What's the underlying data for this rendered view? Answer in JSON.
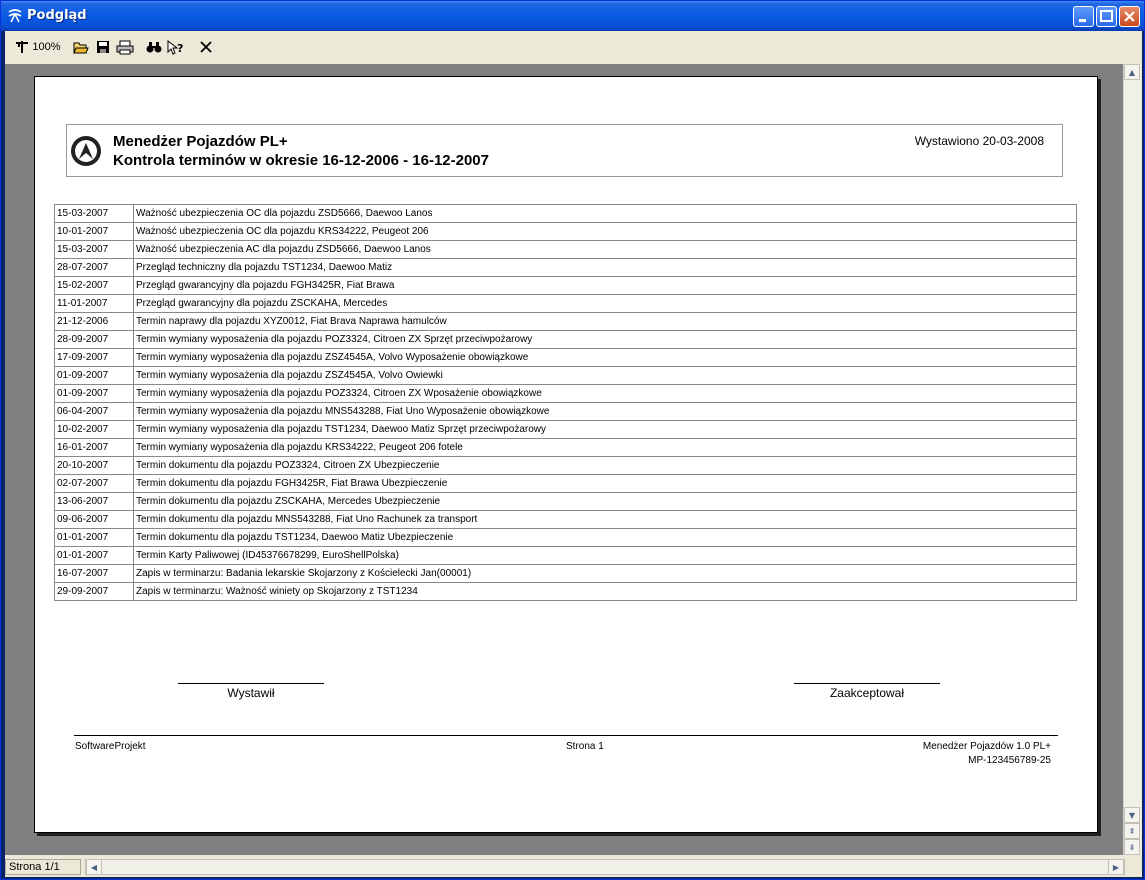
{
  "window": {
    "title": "Podgląd"
  },
  "toolbar": {
    "zoom_label": "100%",
    "tools": [
      "zoom-icon",
      "open-icon",
      "save-icon",
      "print-icon",
      "find-icon",
      "help-icon",
      "close-icon"
    ]
  },
  "report": {
    "title": "Menedżer Pojazdów PL+",
    "subtitle": "Kontrola terminów w okresie 16-12-2006 - 16-12-2007",
    "issued": "Wystawiono 20-03-2008",
    "rows": [
      {
        "date": "15-03-2007",
        "desc": "Ważność ubezpieczenia OC dla pojazdu ZSD5666, Daewoo Lanos"
      },
      {
        "date": "10-01-2007",
        "desc": "Ważność ubezpieczenia OC dla pojazdu KRS34222, Peugeot 206"
      },
      {
        "date": "15-03-2007",
        "desc": "Ważność ubezpieczenia AC dla pojazdu  ZSD5666, Daewoo Lanos"
      },
      {
        "date": "28-07-2007",
        "desc": "Przegląd techniczny dla pojazdu  TST1234, Daewoo Matiz"
      },
      {
        "date": "15-02-2007",
        "desc": "Przegląd gwarancyjny dla pojazdu  FGH3425R, Fiat Brawa"
      },
      {
        "date": "11-01-2007",
        "desc": "Przegląd gwarancyjny dla pojazdu  ZSCKAHA, Mercedes"
      },
      {
        "date": "21-12-2006",
        "desc": "Termin naprawy dla pojazdu  XYZ0012, Fiat Brava Naprawa hamulców"
      },
      {
        "date": "28-09-2007",
        "desc": "Termin wymiany wyposażenia dla pojazdu  POZ3324, Citroen ZX Sprzęt przeciwpożarowy"
      },
      {
        "date": "17-09-2007",
        "desc": "Termin wymiany wyposażenia dla pojazdu  ZSZ4545A, Volvo Wyposażenie obowiązkowe"
      },
      {
        "date": "01-09-2007",
        "desc": "Termin wymiany wyposażenia dla pojazdu  ZSZ4545A, Volvo Owiewki"
      },
      {
        "date": "01-09-2007",
        "desc": "Termin wymiany wyposażenia dla pojazdu  POZ3324, Citroen ZX Wposażenie obowiązkowe"
      },
      {
        "date": "06-04-2007",
        "desc": "Termin wymiany wyposażenia dla pojazdu  MNS543288, Fiat Uno Wyposażenie obowiązkowe"
      },
      {
        "date": "10-02-2007",
        "desc": "Termin wymiany wyposażenia dla pojazdu  TST1234, Daewoo Matiz Sprzęt przeciwpożarowy"
      },
      {
        "date": "16-01-2007",
        "desc": "Termin wymiany wyposażenia dla pojazdu  KRS34222, Peugeot 206 fotele"
      },
      {
        "date": "20-10-2007",
        "desc": "Termin dokumentu dla pojazdu  POZ3324, Citroen ZX Ubezpieczenie"
      },
      {
        "date": "02-07-2007",
        "desc": "Termin dokumentu dla pojazdu  FGH3425R, Fiat Brawa Ubezpieczenie"
      },
      {
        "date": "13-06-2007",
        "desc": "Termin dokumentu dla pojazdu  ZSCKAHA, Mercedes Ubezpieczenie"
      },
      {
        "date": "09-06-2007",
        "desc": "Termin dokumentu dla pojazdu  MNS543288, Fiat Uno Rachunek za transport"
      },
      {
        "date": "01-01-2007",
        "desc": "Termin dokumentu dla pojazdu  TST1234, Daewoo Matiz Ubezpieczenie"
      },
      {
        "date": "01-01-2007",
        "desc": "Termin Karty Paliwowej  (ID45376678299, EuroShellPolska)"
      },
      {
        "date": "16-07-2007",
        "desc": "Zapis w terminarzu: Badania lekarskie  Skojarzony z Kościelecki Jan(00001)"
      },
      {
        "date": "29-09-2007",
        "desc": "Zapis w terminarzu: Ważność winiety op Skojarzony z TST1234"
      }
    ],
    "sign_left": "Wystawił",
    "sign_right": "Zaakceptował",
    "footer_left": "SoftwareProjekt",
    "footer_center": "Strona 1",
    "footer_right_1": "Menedżer Pojazdów 1.0 PL+",
    "footer_right_2": "MP-123456789-25"
  },
  "status": {
    "page_text": "Strona 1/1"
  }
}
